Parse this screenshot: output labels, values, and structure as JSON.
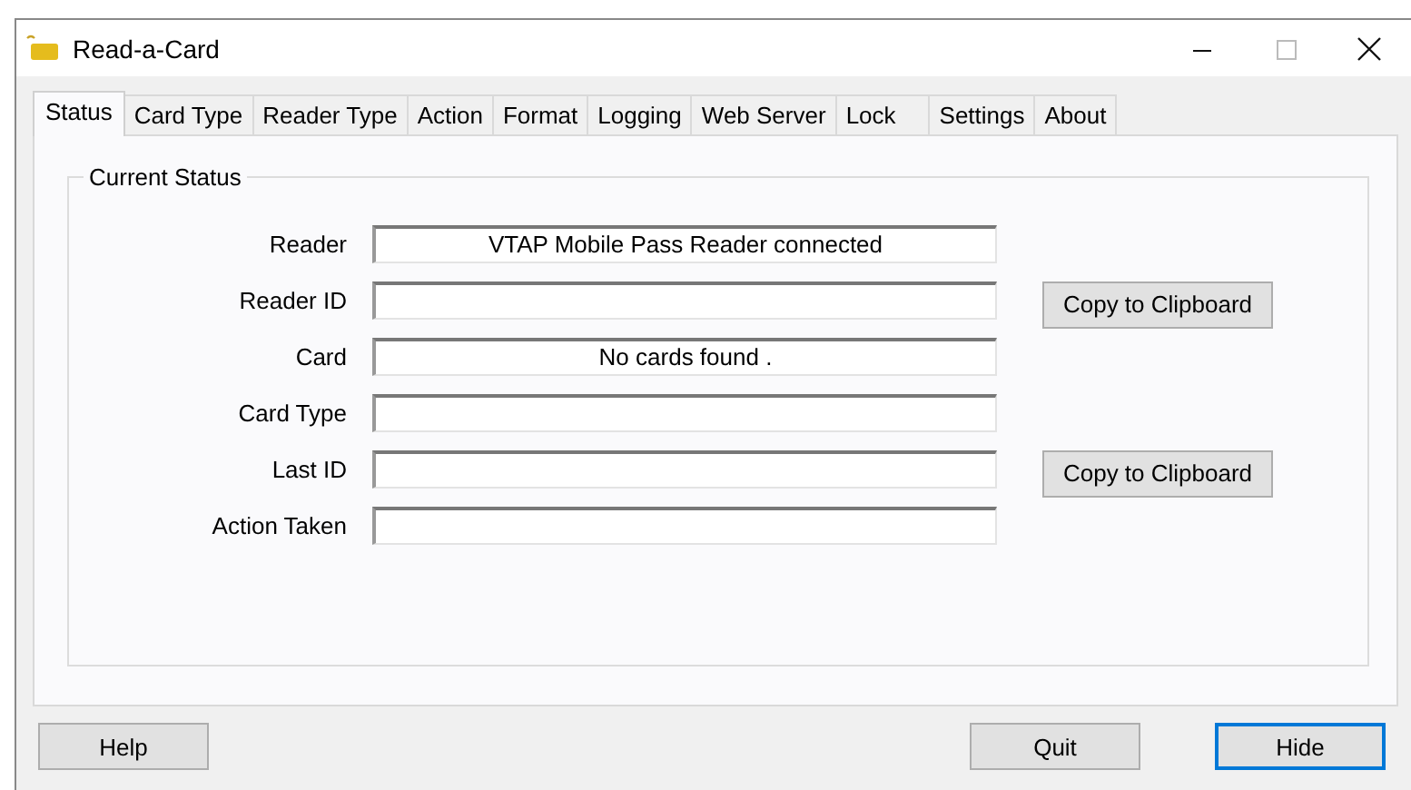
{
  "window": {
    "title": "Read-a-Card"
  },
  "tabs": [
    {
      "label": "Status",
      "selected": true
    },
    {
      "label": "Card Type",
      "selected": false
    },
    {
      "label": "Reader Type",
      "selected": false
    },
    {
      "label": "Action",
      "selected": false
    },
    {
      "label": "Format",
      "selected": false
    },
    {
      "label": "Logging",
      "selected": false
    },
    {
      "label": "Web Server",
      "selected": false
    },
    {
      "label": "Lock",
      "selected": false
    },
    {
      "label": "Settings",
      "selected": false
    },
    {
      "label": "About",
      "selected": false
    }
  ],
  "group": {
    "title": "Current Status",
    "rows": [
      {
        "label": "Reader",
        "value": "VTAP Mobile Pass Reader connected"
      },
      {
        "label": "Reader ID",
        "value": "",
        "button": "Copy to Clipboard"
      },
      {
        "label": "Card",
        "value": "No cards found ."
      },
      {
        "label": "Card Type",
        "value": ""
      },
      {
        "label": "Last ID",
        "value": "",
        "button": "Copy to Clipboard"
      },
      {
        "label": "Action Taken",
        "value": ""
      }
    ]
  },
  "left_buttons": [
    {
      "label": "Help",
      "focused": false
    }
  ],
  "right_buttons": [
    {
      "label": "Quit",
      "focused": false
    },
    {
      "label": "Hide",
      "focused": true
    }
  ]
}
